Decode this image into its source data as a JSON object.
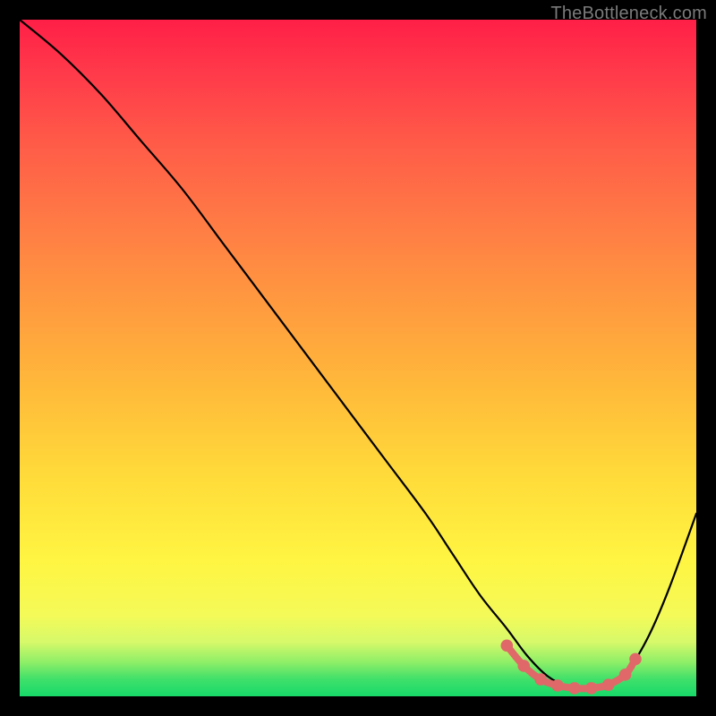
{
  "watermark": "TheBottleneck.com",
  "colors": {
    "background": "#000000",
    "curve": "#000000",
    "marker": "#e06868",
    "gradient_top": "#ff1f47",
    "gradient_mid": "#ffdc3a",
    "gradient_bottom": "#17d969"
  },
  "chart_data": {
    "type": "line",
    "title": "",
    "xlabel": "",
    "ylabel": "",
    "xlim": [
      0,
      100
    ],
    "ylim": [
      0,
      100
    ],
    "grid": false,
    "legend": false,
    "series": [
      {
        "name": "bottleneck-curve",
        "x": [
          0,
          6,
          12,
          18,
          24,
          30,
          36,
          42,
          48,
          54,
          60,
          64,
          68,
          72,
          75,
          78,
          81,
          84,
          87,
          90,
          93,
          96,
          100
        ],
        "values": [
          100,
          95,
          89,
          82,
          75,
          67,
          59,
          51,
          43,
          35,
          27,
          21,
          15,
          10,
          6,
          3,
          1.5,
          1,
          1.5,
          4,
          9,
          16,
          27
        ]
      },
      {
        "name": "optimal-range-markers",
        "x": [
          72,
          74.5,
          77,
          79.5,
          82,
          84.5,
          87,
          89.5,
          91
        ],
        "values": [
          7.5,
          4.5,
          2.5,
          1.6,
          1.2,
          1.2,
          1.7,
          3.2,
          5.5
        ]
      }
    ],
    "annotations": []
  }
}
